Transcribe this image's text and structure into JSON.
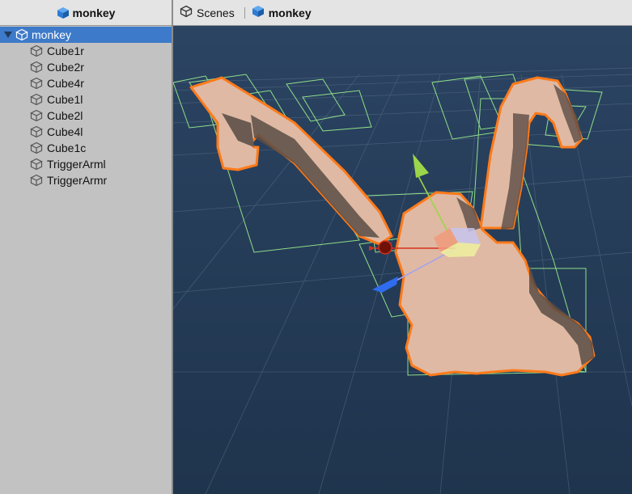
{
  "hierarchy": {
    "header_title": "monkey",
    "root_item": "monkey",
    "children": [
      "Cube1r",
      "Cube2r",
      "Cube4r",
      "Cube1l",
      "Cube2l",
      "Cube4l",
      "Cube1c",
      "TriggerArml",
      "TriggerArmr"
    ]
  },
  "scene": {
    "breadcrumb": [
      {
        "label": "Scenes",
        "icon": "unity-logo-icon"
      },
      {
        "label": "monkey",
        "icon": "prefab-cube-icon"
      }
    ]
  },
  "colors": {
    "viewport_bg": "#243a55",
    "selection_outline": "#ff7a1a",
    "mesh_fill": "#dfb9a3",
    "collider_wire": "#9cf08e",
    "row_selected": "#3d7ac9",
    "gizmo_x": "#d7301c",
    "gizmo_y": "#9bd64a",
    "gizmo_z": "#2f6cf0"
  }
}
